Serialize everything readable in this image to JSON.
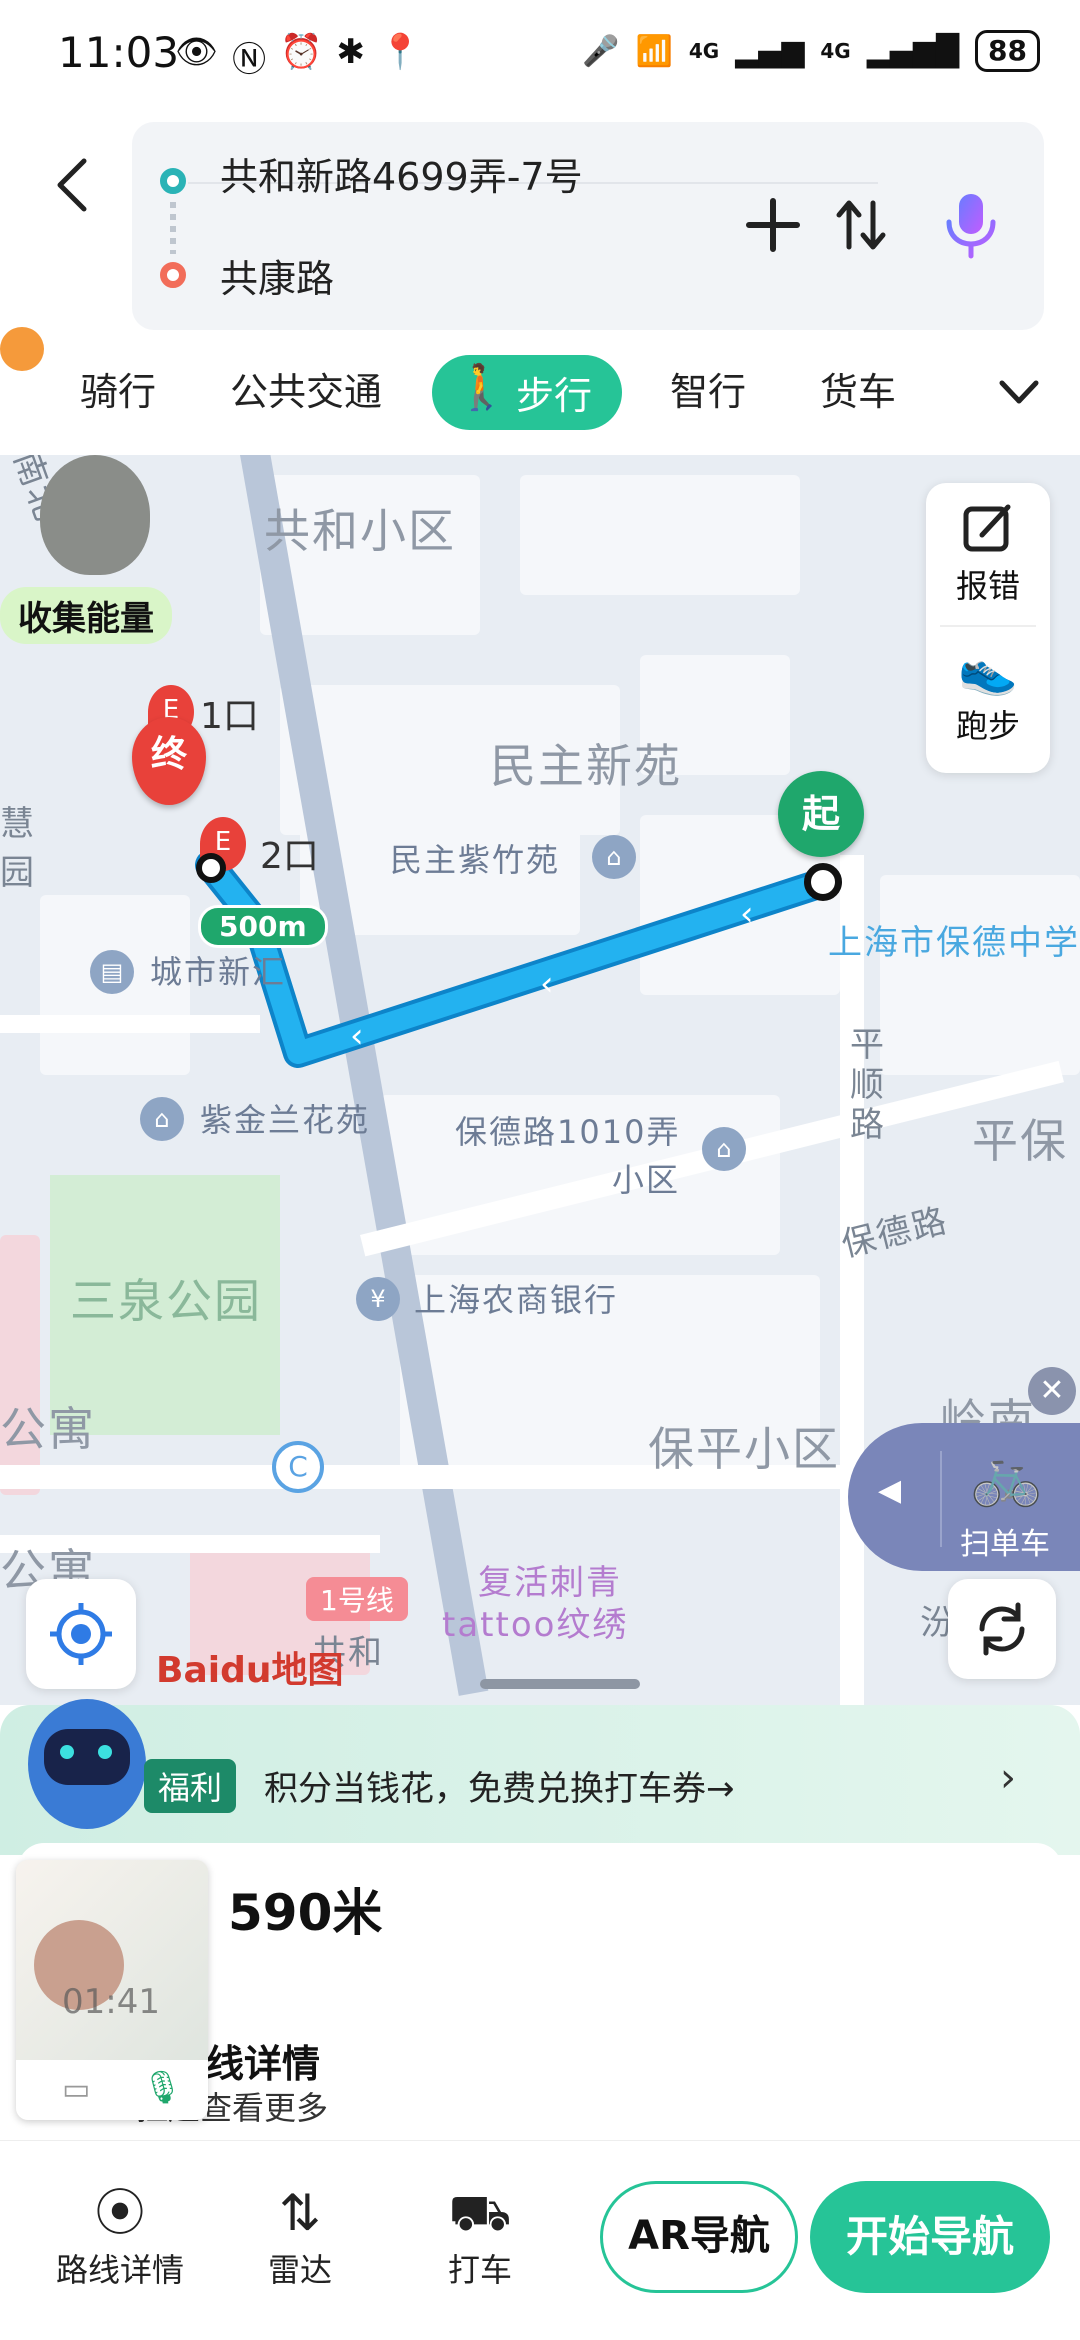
{
  "status_bar": {
    "time": "11:03",
    "battery": "88",
    "network_1": "4G",
    "network_2": "4G"
  },
  "route": {
    "from": "共和新路4699弄-7号",
    "to": "共康路"
  },
  "tabs": [
    {
      "label": "骑行"
    },
    {
      "label": "公共交通"
    },
    {
      "label": "步行"
    },
    {
      "label": "智行"
    },
    {
      "label": "货车"
    }
  ],
  "map": {
    "labels": {
      "gonghe": "共和小区",
      "minzhu": "民主新苑",
      "zizhu": "民主紫竹苑",
      "chengshi": "城市新汇",
      "zijin": "紫金兰花苑",
      "baode1010_a": "保德路1010弄",
      "baode1010_b": "小区",
      "sanquan": "三泉公园",
      "nongshang": "上海农商银行",
      "baoping": "保平小区",
      "baodezhongxue": "上海市保德中学",
      "pingshun": "平顺路",
      "baodelu": "保德路",
      "pingbao": "平保",
      "gongyu": "公寓",
      "lingnan": "岭南小",
      "line1": "1号线",
      "fuhuo_a": "复活刺青",
      "fuhuo_b": "tattoo纹绣",
      "gonghe_road": "共和",
      "nanbei": "南北",
      "hui": "慧",
      "yuan": "园",
      "gongyu2": "公寓",
      "sha": "汾"
    },
    "energy_label": "收集能量",
    "exit1": "1口",
    "exit2": "2口",
    "end_marker": "终",
    "start_marker": "起",
    "distance_badge": "500m",
    "report_label": "报错",
    "run_label": "跑步",
    "scan_bike": "扫单车",
    "logo": "Baidu地图"
  },
  "promo": {
    "badge": "福利",
    "text": "积分当钱花，免费兑换打车券→"
  },
  "card": {
    "distance": "590米",
    "detail_title": "路线详情",
    "detail_sub": "拉起查看更多",
    "video_time": "01:41"
  },
  "bottom_bar": {
    "route_detail": "路线详情",
    "radar": "雷达",
    "taxi": "打车",
    "ar_nav": "AR导航",
    "start_nav": "开始导航"
  },
  "colors": {
    "accent": "#26c497",
    "route": "#1aa8e8",
    "end": "#e8413a"
  }
}
